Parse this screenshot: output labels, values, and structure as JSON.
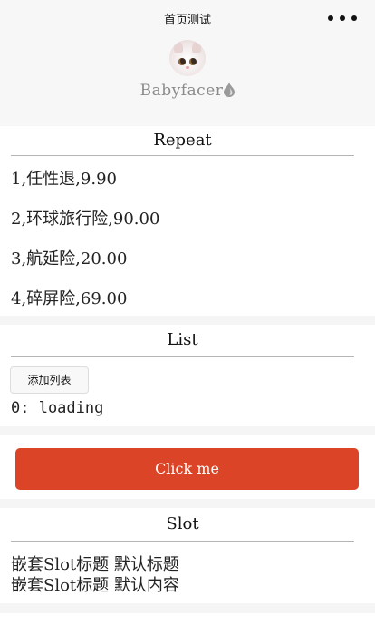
{
  "nav": {
    "title": "首页测试",
    "more_icon": "more-dots-icon"
  },
  "profile": {
    "username": "Babyfacer",
    "avatar_icon": "cat-avatar-icon",
    "badge_icon": "flame-drop-icon"
  },
  "repeat": {
    "title": "Repeat",
    "items": [
      "1,任性退,9.90",
      "2,环球旅行险,90.00",
      "3,航延险,20.00",
      "4,碎屏险,69.00"
    ]
  },
  "list": {
    "title": "List",
    "add_button": "添加列表",
    "items": [
      "0: loading"
    ]
  },
  "click_button": {
    "label": "Click me",
    "color": "#db4426"
  },
  "slot": {
    "title": "Slot",
    "lines": [
      "嵌套Slot标题 默认标题",
      "嵌套Slot标题 默认内容"
    ]
  }
}
